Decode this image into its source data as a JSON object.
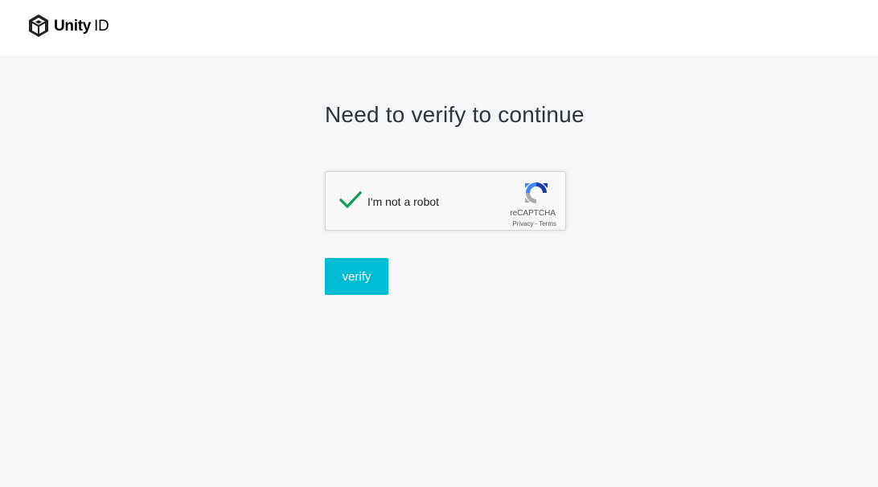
{
  "header": {
    "logo": {
      "icon": "unity-cube-icon",
      "brand": "Unity",
      "suffix": "ID"
    }
  },
  "main": {
    "title": "Need to verify to continue",
    "recaptcha": {
      "checked": true,
      "label": "I'm not a robot",
      "brand": "reCAPTCHA",
      "privacy_link": "Privacy",
      "separator": "-",
      "terms_link": "Terms"
    },
    "verify_button": {
      "label": "verify"
    }
  },
  "colors": {
    "page_background": "#f4f6f7",
    "header_background": "#ffffff",
    "button_accent": "#00bcd4",
    "check_green": "#0f9d58"
  }
}
